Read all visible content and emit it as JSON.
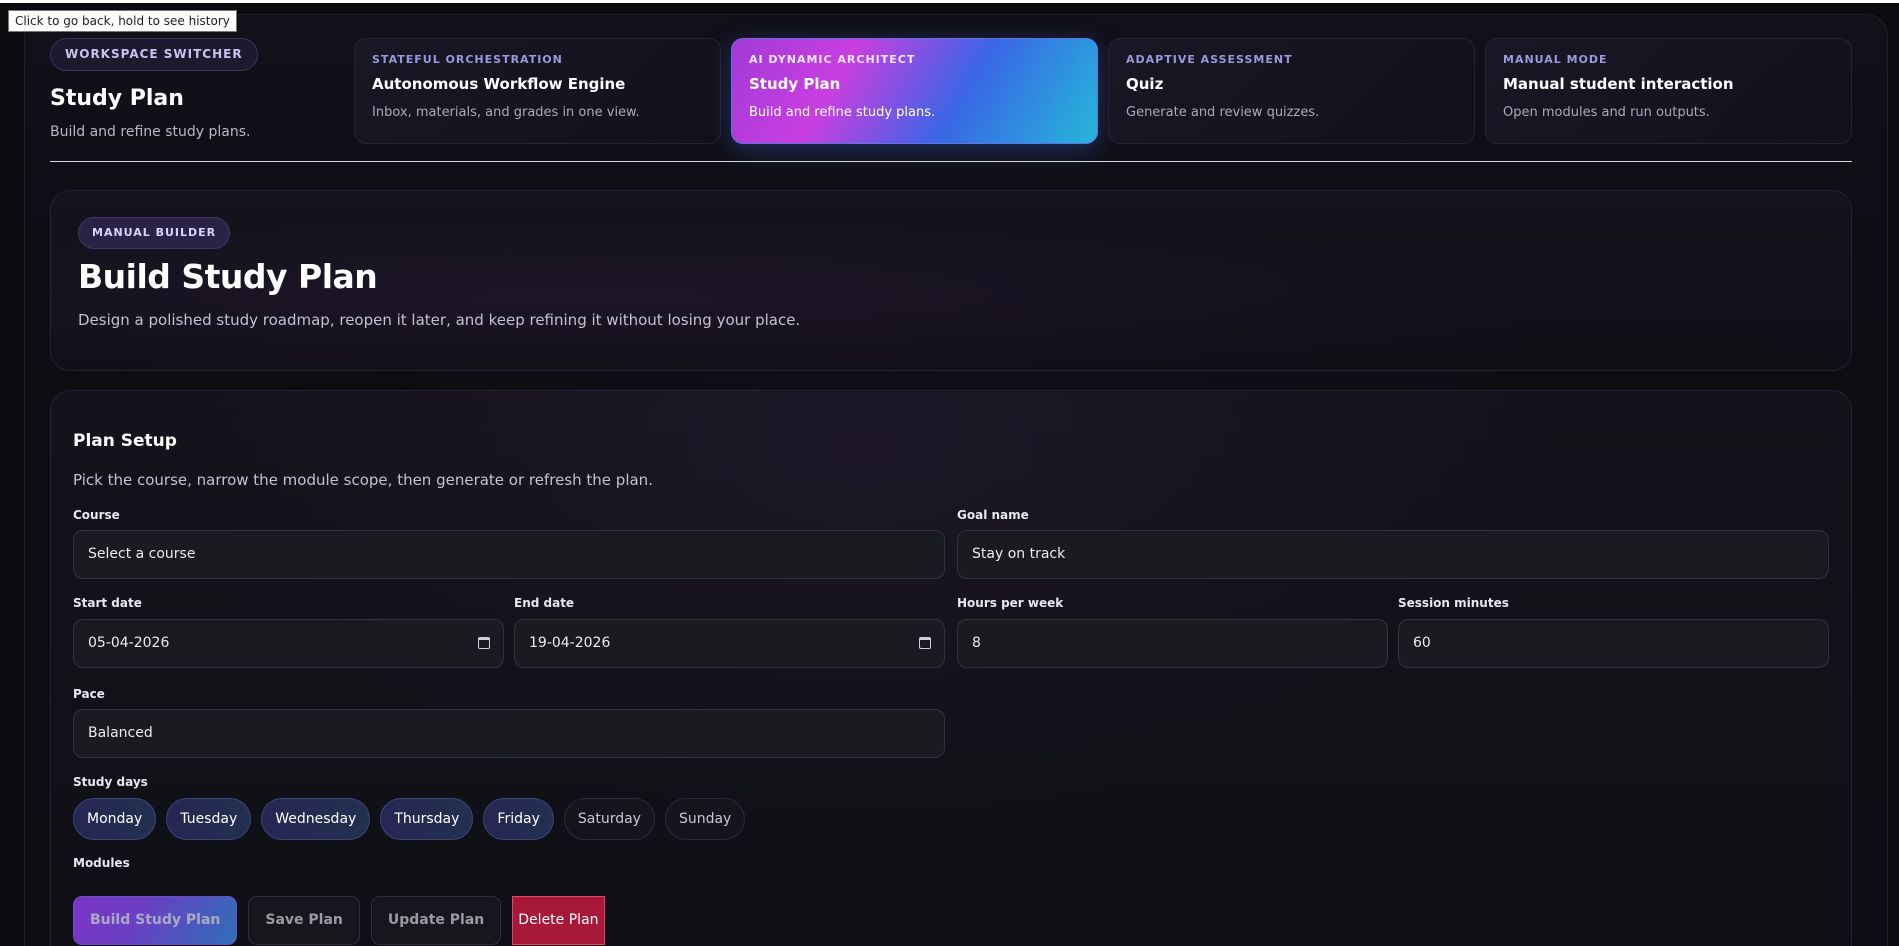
{
  "tooltip": "Click to go back, hold to see history",
  "workspace": {
    "pill": "WORKSPACE SWITCHER",
    "title": "Study Plan",
    "subtitle": "Build and refine study plans."
  },
  "modes": [
    {
      "eyebrow": "STATEFUL ORCHESTRATION",
      "title": "Autonomous Workflow Engine",
      "desc": "Inbox, materials, and grades in one view."
    },
    {
      "eyebrow": "AI DYNAMIC ARCHITECT",
      "title": "Study Plan",
      "desc": "Build and refine study plans."
    },
    {
      "eyebrow": "ADAPTIVE ASSESSMENT",
      "title": "Quiz",
      "desc": "Generate and review quizzes."
    },
    {
      "eyebrow": "MANUAL MODE",
      "title": "Manual student interaction",
      "desc": "Open modules and run outputs."
    }
  ],
  "hero": {
    "pill": "MANUAL BUILDER",
    "title": "Build Study Plan",
    "subtitle": "Design a polished study roadmap, reopen it later, and keep refining it without losing your place."
  },
  "setup": {
    "title": "Plan Setup",
    "subtitle": "Pick the course, narrow the module scope, then generate or refresh the plan.",
    "course": {
      "label": "Course",
      "value": "Select a course"
    },
    "goal": {
      "label": "Goal name",
      "value": "Stay on track"
    },
    "start": {
      "label": "Start date",
      "value": "05-04-2026"
    },
    "end": {
      "label": "End date",
      "value": "19-04-2026"
    },
    "hours": {
      "label": "Hours per week",
      "value": "8"
    },
    "session": {
      "label": "Session minutes",
      "value": "60"
    },
    "pace": {
      "label": "Pace",
      "value": "Balanced"
    },
    "days_label": "Study days",
    "days": [
      "Monday",
      "Tuesday",
      "Wednesday",
      "Thursday",
      "Friday",
      "Saturday",
      "Sunday"
    ],
    "modules_label": "Modules",
    "buttons": {
      "build": "Build Study Plan",
      "save": "Save Plan",
      "update": "Update Plan",
      "delete": "Delete Plan"
    }
  }
}
